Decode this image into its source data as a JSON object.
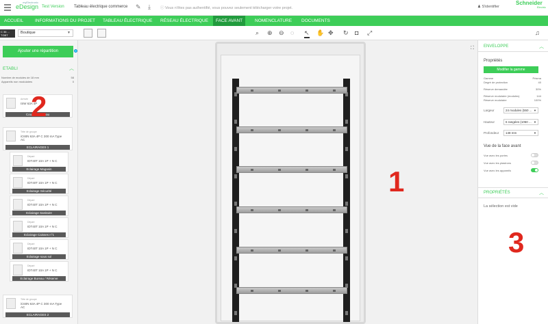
{
  "topbar": {
    "logo_small": "myElectronic",
    "logo_main": "eDesign",
    "version": "Test Version",
    "project_name": "Tableau électrique commerce",
    "auth_message": "Vous n'êtes pas authentifié, vous pouvez seulement télécharger votre projet.",
    "signin_label": "S'identifier",
    "brand": "Schneider",
    "brand_sub": "Electric"
  },
  "nav": {
    "tabs": [
      {
        "label": "Accueil"
      },
      {
        "label": "Informations du projet"
      },
      {
        "label": "Tableau électrique"
      },
      {
        "label": "Réseau électrique"
      },
      {
        "label": "Face avant"
      },
      {
        "label": "Nomenclature"
      },
      {
        "label": "Documents"
      }
    ],
    "active": "Face avant"
  },
  "toolbar": {
    "badge": "C 36 ... TGBT",
    "type_value": "Boutique"
  },
  "left": {
    "add_button": "Ajouter une répartition",
    "section_title": "ETABLI",
    "stats": [
      {
        "label": "Nombre de modules de 18 mm",
        "value": "58"
      },
      {
        "label": "Appareils non modulaires",
        "value": "0"
      }
    ],
    "items": [
      {
        "cat": "Arrivée",
        "desc": "ISW 63A 4P",
        "label": "Coupure Tableau"
      },
      {
        "cat": "Tête de groupe",
        "desc": "iC60N 63A 4P C 300 mA Type AC",
        "label": "ECLAIRAGES 1"
      },
      {
        "cat": "Départ",
        "desc": "IDT40T 10A 1P + N C",
        "label": "Eclairage Magasin"
      },
      {
        "cat": "Départ",
        "desc": "IDT40T 10A 1P + N C",
        "label": "Eclairage Sécurité"
      },
      {
        "cat": "Départ",
        "desc": "IDT40T 10A 1P + N C",
        "label": "Eclairage Sanitaire"
      },
      {
        "cat": "Départ",
        "desc": "IDT40T 10A 1P + N C",
        "label": "Eclairage Caisses n°1"
      },
      {
        "cat": "Départ",
        "desc": "IDT40T 10A 1P + N C",
        "label": "Eclairage sous sol"
      },
      {
        "cat": "Départ",
        "desc": "IDT40T 10A 1P + N C",
        "label": "Eclairage Bureau / Réserve"
      },
      {
        "cat": "Tête de groupe",
        "desc": "iC60N 63A 4P C 300 mA Type AC",
        "label": "ECLAIRAGES 2"
      }
    ],
    "annotation": "2"
  },
  "canvas": {
    "annotation": "1"
  },
  "right": {
    "envelope_title": "ENVELOPPE",
    "properties_label": "Propriétés",
    "modify_button": "Modifier la gamme",
    "rows": [
      {
        "label": "Gamme",
        "value": "Prisma"
      },
      {
        "label": "Degré de protection",
        "value": "40"
      },
      {
        "label": "Réserve demandée",
        "value": "30%"
      },
      {
        "label": "Réserve modulaire (modules)",
        "value": "144"
      },
      {
        "label": "Réserve modulaire",
        "value": "100%"
      }
    ],
    "fields": [
      {
        "label": "Largeur",
        "value": "24 modules (550 ..."
      },
      {
        "label": "Hauteur",
        "value": "6 rangées (1050 ..."
      },
      {
        "label": "Profondeur",
        "value": "148 mm"
      }
    ],
    "front_view_title": "Vue de la face avant",
    "toggles": [
      {
        "label": "Vue avec les portes",
        "on": false
      },
      {
        "label": "Vue avec les plastrons",
        "on": false
      },
      {
        "label": "Vue avec les appareils",
        "on": true
      }
    ],
    "props_title": "PROPRIÉTÉS",
    "empty_message": "La sélection est vide",
    "annotation": "3"
  }
}
